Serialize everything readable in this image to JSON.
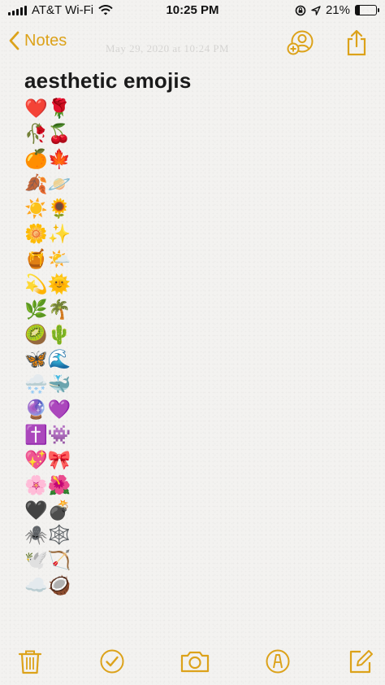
{
  "status_bar": {
    "carrier": "AT&T Wi-Fi",
    "time": "10:25 PM",
    "battery_percent": "21%",
    "battery_level": 0.21
  },
  "nav": {
    "back_label": "Notes",
    "faint_date": "May 29, 2020 at 10:24 PM",
    "accent_color": "#dca21a"
  },
  "note": {
    "title": "aesthetic emojis",
    "rows": [
      "❤️🌹",
      "🥀🍒",
      "🍊🍁",
      "🍂🪐",
      "☀️🌻",
      "🌼✨",
      "🍯🌤️",
      "💫🌞",
      "🌿🌴",
      "🥝🌵",
      "🦋🌊",
      "🌨️🐳",
      "🔮💜",
      "✝️👾",
      "💖🎀",
      "🌸🌺",
      "🖤💣",
      "🕷️🕸️",
      "🕊️🏹",
      "☁️🥥"
    ]
  },
  "toolbar": {
    "icons": [
      "trash-icon",
      "checklist-icon",
      "camera-icon",
      "markup-icon",
      "compose-icon"
    ]
  }
}
